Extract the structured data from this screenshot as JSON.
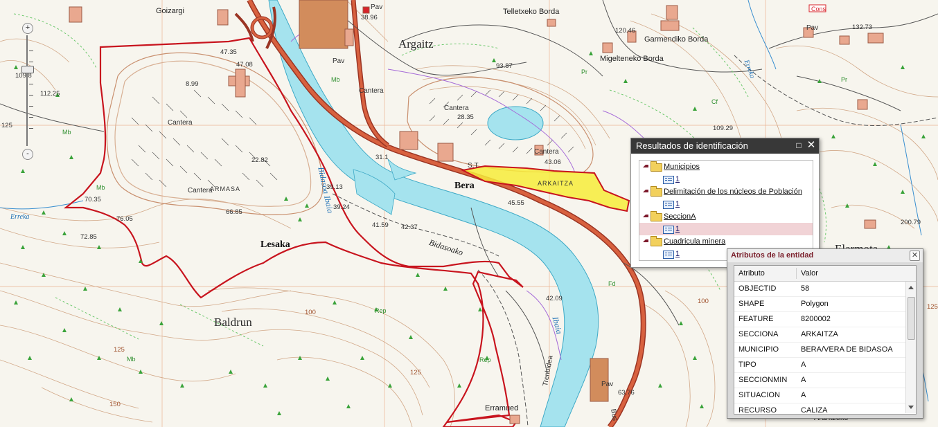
{
  "map": {
    "place_labels": {
      "argaitz": "Argaitz",
      "goizargi": "Goizargi",
      "telletxeko_borda": "Telletxeko Borda",
      "garmendiko_borda": "Garmendiko Borda",
      "migelteneko_borda": "Migelteneko Borda",
      "bera": "Bera",
      "lesaka": "Lesaka",
      "baldrun": "Baldrun",
      "erramuedi": "Erramued",
      "elarmota": "Elarmota",
      "arantzoko": "Arantzoko"
    },
    "feature_labels": {
      "cantera": "Cantera",
      "st": "S.T",
      "pav": "Pav",
      "armasa": "ARMASA",
      "arkaitza": "ARKAITZA",
      "cons": "Cons",
      "rep": "Rep",
      "mb": "Mb",
      "pr": "Pr",
      "fd": "Fd",
      "cf": "Cf"
    },
    "water_labels": {
      "bidasoa_ibaia": "Bidasoa Ibaia",
      "bidasoako": "Bidasoako",
      "ibaia": "Ibaia",
      "erreka_left": "Erreka",
      "erreka_right": "Erreka",
      "trenbidea": "Trenbidea",
      "bus": "Bus"
    },
    "elevations": [
      "8.99",
      "22.82",
      "28.35",
      "43.06",
      "38.96",
      "93.87",
      "120.46",
      "132.73",
      "112.25",
      "109.8",
      "47.35",
      "70.35",
      "76.05",
      "72.85",
      "39.24",
      "66.85",
      "39.13",
      "41.59",
      "42.37",
      "45.55",
      "42.09",
      "31.1",
      "47.08",
      "200.79",
      "63.76",
      "109.29",
      "125"
    ],
    "contour_labels": [
      "125",
      "150",
      "100",
      "125",
      "100",
      "125"
    ]
  },
  "identify_panel": {
    "title": "Resultados de identificación",
    "maximize_icon": "maximize-icon",
    "close_icon": "close-icon",
    "layers": [
      {
        "name": "Municipios",
        "features": [
          "1"
        ]
      },
      {
        "name": "Delimitación de los núcleos de Población",
        "features": [
          "1"
        ]
      },
      {
        "name": "SeccionA",
        "features": [
          "1"
        ],
        "selected": true
      },
      {
        "name": "Cuadricula minera",
        "features": [
          "1"
        ]
      }
    ]
  },
  "attributes_panel": {
    "title": "Atributos de la entidad",
    "col_attribute": "Atributo",
    "col_value": "Valor",
    "rows": [
      {
        "attr": "OBJECTID",
        "value": "58"
      },
      {
        "attr": "SHAPE",
        "value": "Polygon"
      },
      {
        "attr": "FEATURE",
        "value": "8200002"
      },
      {
        "attr": "SECCIONA",
        "value": "ARKAITZA"
      },
      {
        "attr": "MUNICIPIO",
        "value": "BERA/VERA DE BIDASOA"
      },
      {
        "attr": "TIPO",
        "value": "A"
      },
      {
        "attr": "SECCIONMIN",
        "value": "A"
      },
      {
        "attr": "SITUACION",
        "value": "A"
      },
      {
        "attr": "RECURSO",
        "value": "CALIZA"
      }
    ]
  },
  "zoom_control": {
    "zoom_in": "+",
    "zoom_out": "-",
    "level_fraction": 0.3
  },
  "colors": {
    "river": "#a5e3ee",
    "road": "#c0482f",
    "boundary": "#c8141e",
    "highlight": "#f7ec3a",
    "contour": "#c79a78",
    "panel_header": "#383838"
  }
}
